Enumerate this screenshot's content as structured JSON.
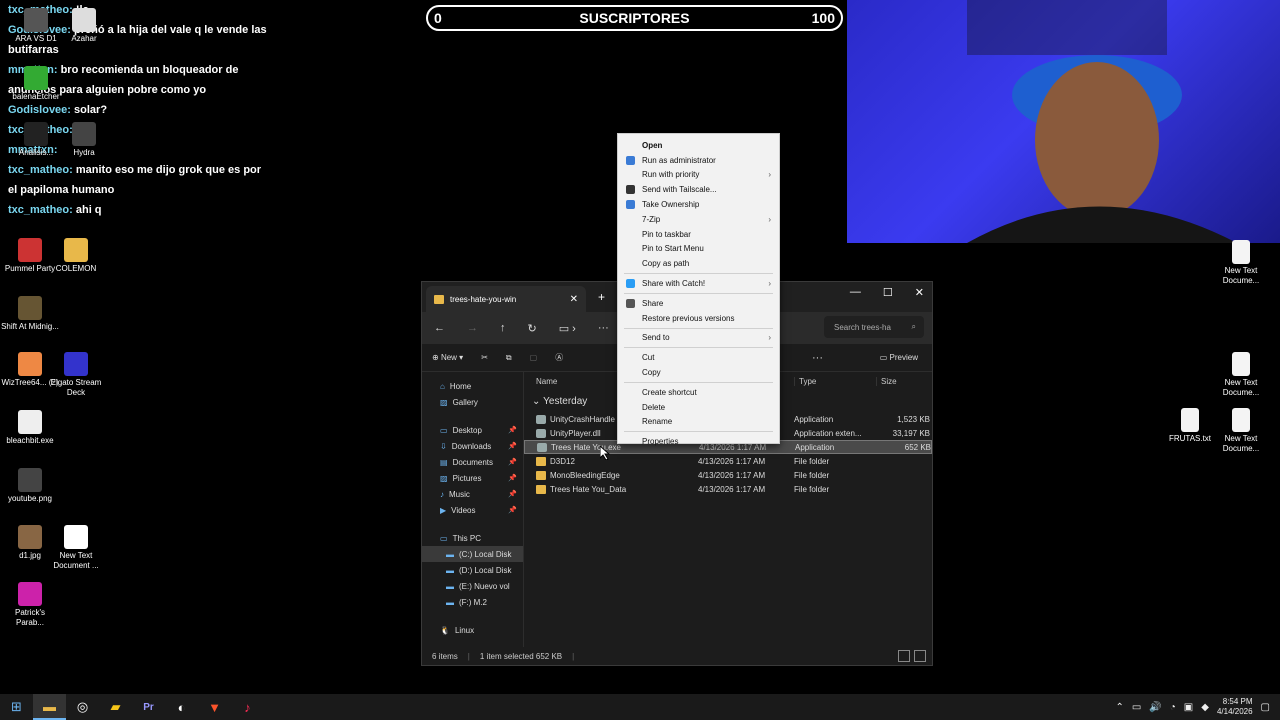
{
  "chat": [
    {
      "user": "txc_matheo:",
      "text": "!la"
    },
    {
      "user": "Godislovee:",
      "text": "preñó a la hija del vale q le vende las butifarras"
    },
    {
      "user": "mmattxn:",
      "text": "bro recomienda un bloqueador de anuncios para alguien pobre como yo"
    },
    {
      "user": "Godislovee:",
      "text": "solar?"
    },
    {
      "user": "txc_matheo:",
      "text": ""
    },
    {
      "user": "mmattxn:",
      "text": ""
    },
    {
      "user": "txc_matheo:",
      "text": "manito eso me dijo grok que es por el papiloma humano"
    },
    {
      "user": "txc_matheo:",
      "text": "ahi q"
    }
  ],
  "subbar": {
    "min": "0",
    "title": "SUSCRIPTORES",
    "max": "100"
  },
  "desktop_left": [
    {
      "label": "ARA VS D1"
    },
    {
      "label": "Azahar"
    },
    {
      "label": "balenaEtcher"
    },
    {
      "label": "Analisis..."
    },
    {
      "label": "Hydra"
    },
    {
      "label": "Pummel Party"
    },
    {
      "label": "COLEMON"
    },
    {
      "label": "Shift At Midnig..."
    },
    {
      "label": "WizTree64... (2)"
    },
    {
      "label": "Elgato Stream Deck"
    },
    {
      "label": "bleachbit.exe"
    },
    {
      "label": "youtube.png"
    },
    {
      "label": "d1.jpg"
    },
    {
      "label": "New Text Document ..."
    },
    {
      "label": "Patrick's Parab..."
    }
  ],
  "desktop_right": [
    {
      "label": "New Text Docume..."
    },
    {
      "label": "New Text Docume..."
    },
    {
      "label": "FRUTAS.txt"
    },
    {
      "label": "New Text Docume..."
    }
  ],
  "explorer": {
    "tab_title": "trees-hate-you-win",
    "search_placeholder": "Search trees-ha",
    "new_label": "New",
    "preview_label": "Preview",
    "nav": [
      {
        "label": "Home"
      },
      {
        "label": "Gallery"
      },
      {
        "label": "Desktop"
      },
      {
        "label": "Downloads"
      },
      {
        "label": "Documents"
      },
      {
        "label": "Pictures"
      },
      {
        "label": "Music"
      },
      {
        "label": "Videos"
      },
      {
        "label": "This PC"
      },
      {
        "label": "(C:) Local Disk"
      },
      {
        "label": "(D:) Local Disk"
      },
      {
        "label": "(E:) Nuevo vol"
      },
      {
        "label": "(F:) M.2"
      },
      {
        "label": "Linux"
      }
    ],
    "columns": {
      "name": "Name",
      "type": "Type",
      "size": "Size"
    },
    "group": "Yesterday",
    "files": [
      {
        "name": "UnityCrashHandle",
        "date": "",
        "type": "Application",
        "size": "1,523 KB"
      },
      {
        "name": "UnityPlayer.dll",
        "date": "",
        "type": "Application exten...",
        "size": "33,197 KB"
      },
      {
        "name": "Trees Hate You.exe",
        "date": "4/13/2026 1:17 AM",
        "type": "Application",
        "size": "652 KB"
      },
      {
        "name": "D3D12",
        "date": "4/13/2026 1:17 AM",
        "type": "File folder",
        "size": ""
      },
      {
        "name": "MonoBleedingEdge",
        "date": "4/13/2026 1:17 AM",
        "type": "File folder",
        "size": ""
      },
      {
        "name": "Trees Hate You_Data",
        "date": "4/13/2026 1:17 AM",
        "type": "File folder",
        "size": ""
      }
    ],
    "status": {
      "count": "6 items",
      "selected": "1 item selected  652 KB"
    }
  },
  "context_menu": [
    {
      "label": "Open",
      "bold": true
    },
    {
      "label": "Run as administrator",
      "icon": "shield-icon"
    },
    {
      "label": "Run with priority",
      "submenu": true
    },
    {
      "label": "Send with Tailscale...",
      "icon": "tailscale-icon"
    },
    {
      "label": "Take Ownership",
      "icon": "shield-icon"
    },
    {
      "label": "7-Zip",
      "submenu": true
    },
    {
      "label": "Pin to taskbar"
    },
    {
      "label": "Pin to Start Menu"
    },
    {
      "label": "Copy as path"
    },
    {
      "sep": true
    },
    {
      "label": "Share with Catch!",
      "submenu": true,
      "icon": "catch-icon"
    },
    {
      "sep": true
    },
    {
      "label": "Share",
      "icon": "share-icon"
    },
    {
      "label": "Restore previous versions"
    },
    {
      "sep": true
    },
    {
      "label": "Send to",
      "submenu": true
    },
    {
      "sep": true
    },
    {
      "label": "Cut"
    },
    {
      "label": "Copy"
    },
    {
      "sep": true
    },
    {
      "label": "Create shortcut"
    },
    {
      "label": "Delete"
    },
    {
      "label": "Rename"
    },
    {
      "sep": true
    },
    {
      "label": "Properties"
    }
  ],
  "taskbar": {
    "time": "8:54 PM",
    "date": "4/14/2026"
  },
  "colors": {
    "accent": "#6cb4f0",
    "folder": "#e8b84a",
    "menu_bg": "#f2f2f2"
  }
}
